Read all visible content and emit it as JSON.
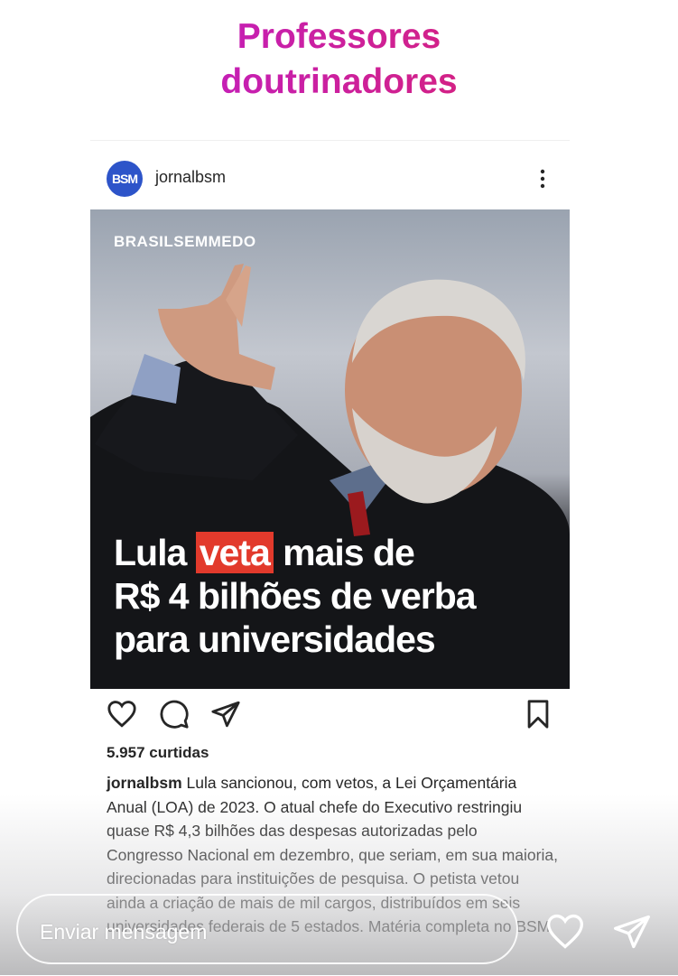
{
  "story": {
    "title_line1": "Professores",
    "title_line2": "doutrinadores"
  },
  "post": {
    "username": "jornalbsm",
    "avatar_text": "BSM",
    "image": {
      "watermark": "BRASILSEMMEDO",
      "headline_part1": "Lula ",
      "headline_highlight": "veta",
      "headline_part2": " mais de",
      "headline_line2": "R$ 4 bilhões de verba",
      "headline_line3": "para universidades"
    },
    "likes": "5.957 curtidas",
    "caption_user": "jornalbsm",
    "caption_text": " Lula sancionou, com vetos, a Lei Orçamentária Anual (LOA) de 2023. O atual chefe do Executivo restringiu quase R$ 4,3 bilhões das despesas autorizadas pelo Congresso Nacional em dezembro, que seriam, em sua maioria, direcionadas para instituições de pesquisa. O petista vetou ainda a criação de mais de mil cargos, distribuídos em seis universidades federais de 5 estados. Matéria completa no BSM"
  },
  "reply": {
    "placeholder": "Enviar mensagem"
  },
  "icons": {
    "more": "more-vertical-icon",
    "like": "heart-icon",
    "comment": "comment-icon",
    "share": "send-icon",
    "save": "bookmark-icon"
  },
  "colors": {
    "title_gradient_start": "#b81ce0",
    "title_gradient_end": "#e0245a",
    "highlight": "#e23a2c",
    "avatar": "#2d54c9"
  }
}
